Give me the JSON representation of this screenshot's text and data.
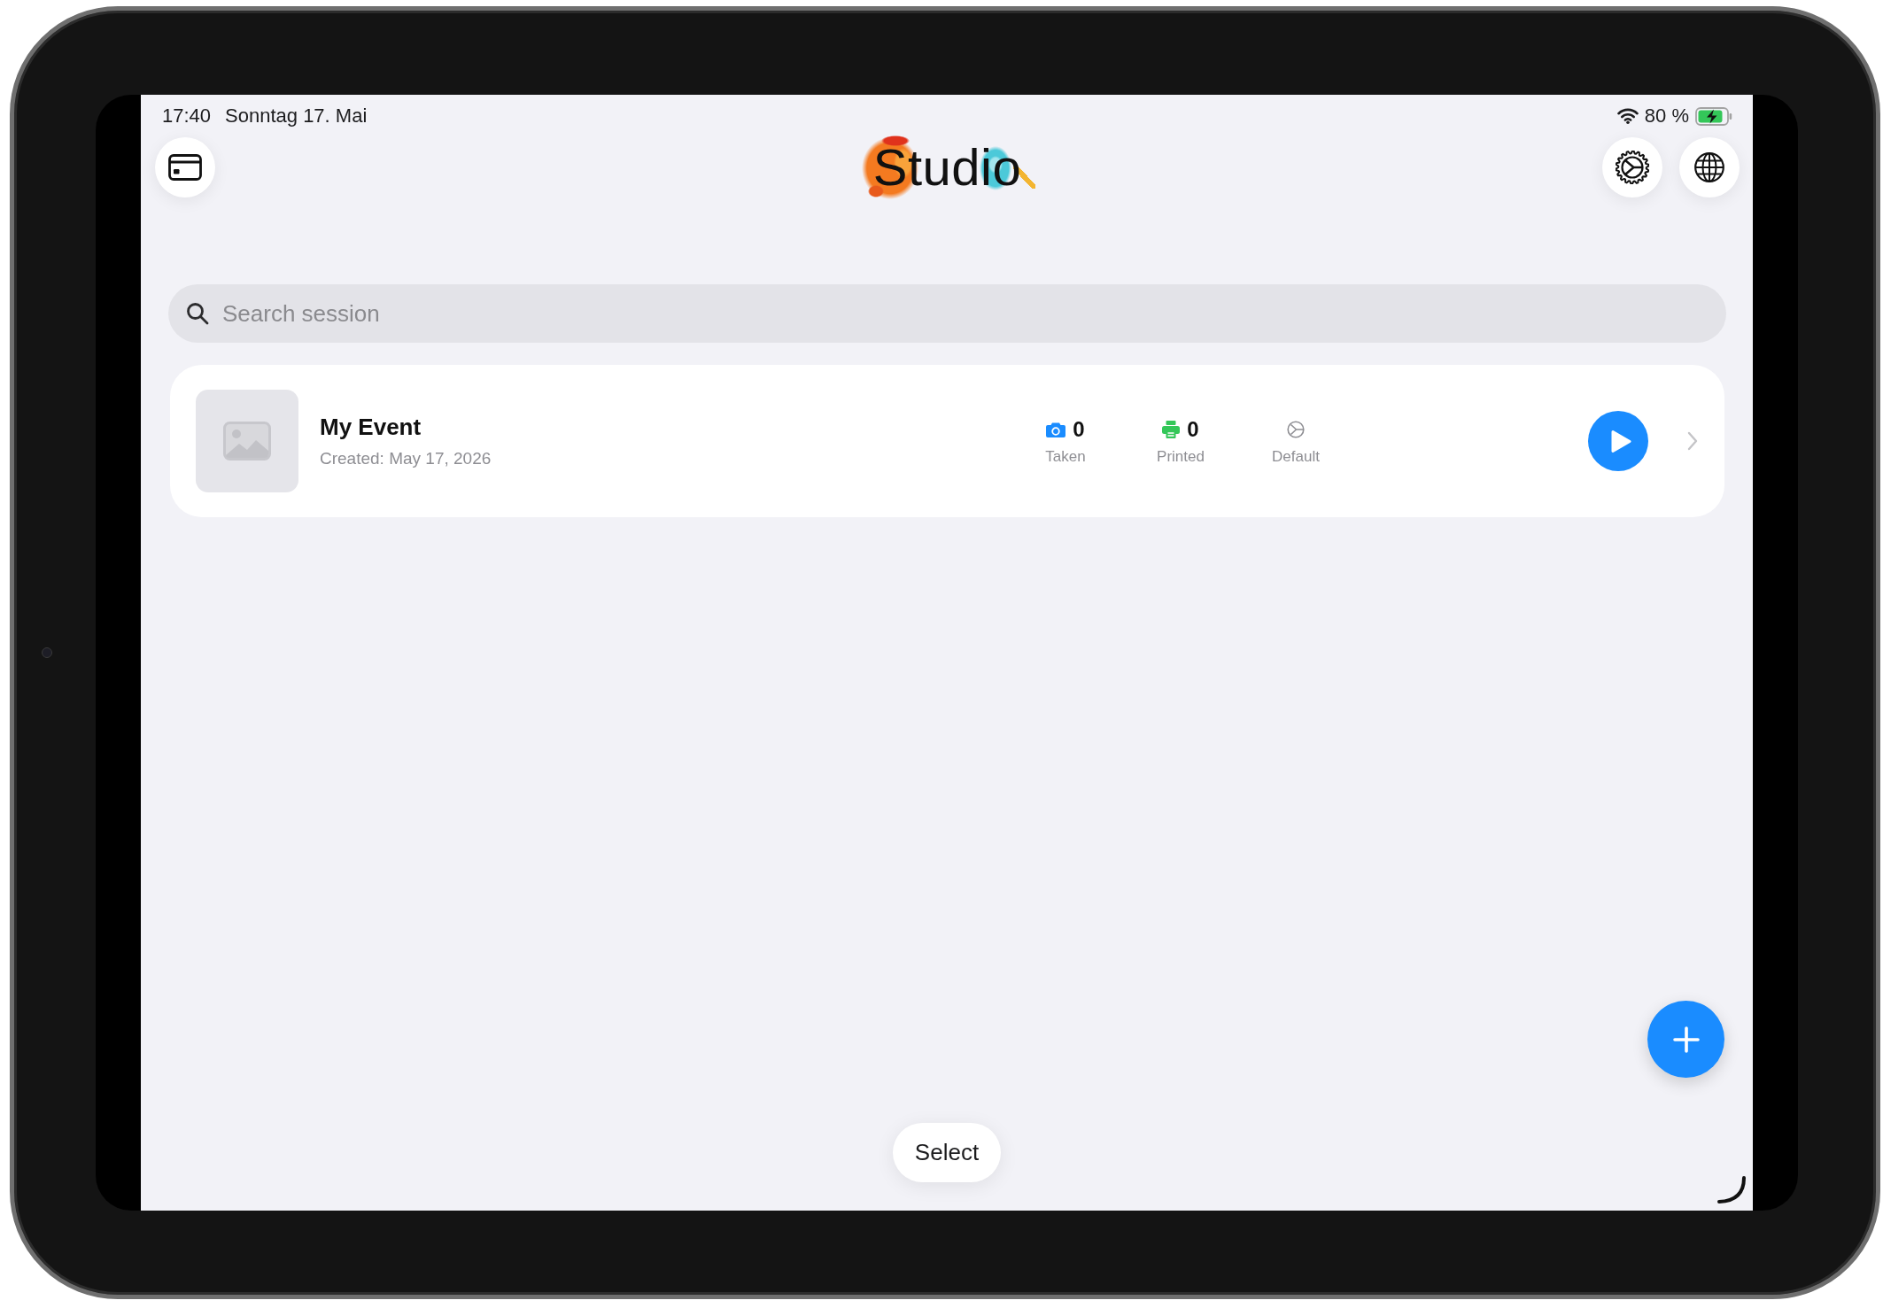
{
  "status_bar": {
    "time": "17:40",
    "date": "Sonntag 17. Mai",
    "battery": "80 %",
    "charging": true
  },
  "header": {
    "logo": "Studio"
  },
  "search": {
    "placeholder": "Search session"
  },
  "sessions": [
    {
      "title": "My Event",
      "created": "Created: May 17, 2026",
      "stats": [
        {
          "kind": "camera",
          "value": "0",
          "label": "Taken",
          "color": "#1a8cff"
        },
        {
          "kind": "printer",
          "value": "0",
          "label": "Printed",
          "color": "#34c759"
        },
        {
          "kind": "preset",
          "label": "Default",
          "color": "#8e8e93"
        }
      ]
    }
  ],
  "select_button": "Select"
}
